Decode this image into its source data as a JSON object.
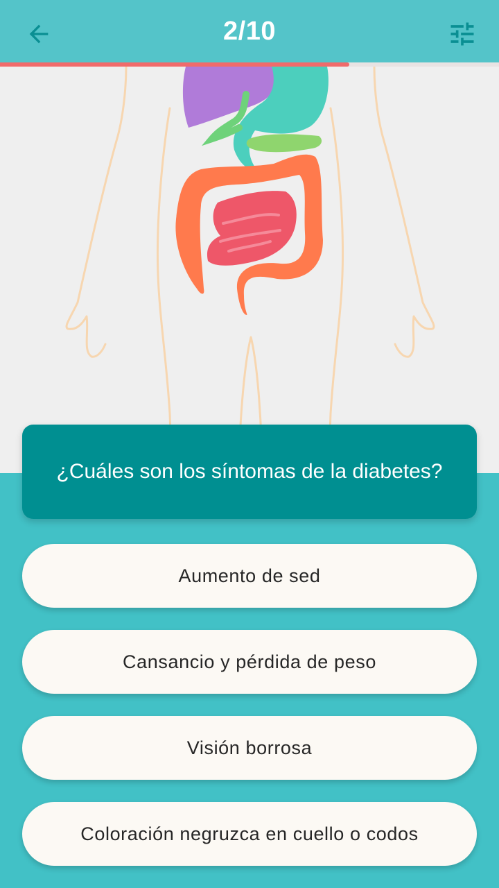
{
  "header": {
    "progress_label": "2/10",
    "progress_fraction": 0.7,
    "back_icon": "arrow-left-icon",
    "filter_icon": "tune-sliders-icon"
  },
  "illustration": {
    "subject": "digestive-system-organs"
  },
  "question": {
    "text": "¿Cuáles son los síntomas de la diabetes?"
  },
  "answers": [
    {
      "label": "Aumento de sed"
    },
    {
      "label": "Cansancio y pérdida de peso"
    },
    {
      "label": "Visión borrosa"
    },
    {
      "label": "Coloración negruzca en cuello o codos"
    }
  ],
  "colors": {
    "app_bar": "#54c4c9",
    "background": "#42c1c6",
    "progress": "#f06b6b",
    "question_card": "#008f91",
    "answer_button": "#fcf9f4"
  }
}
